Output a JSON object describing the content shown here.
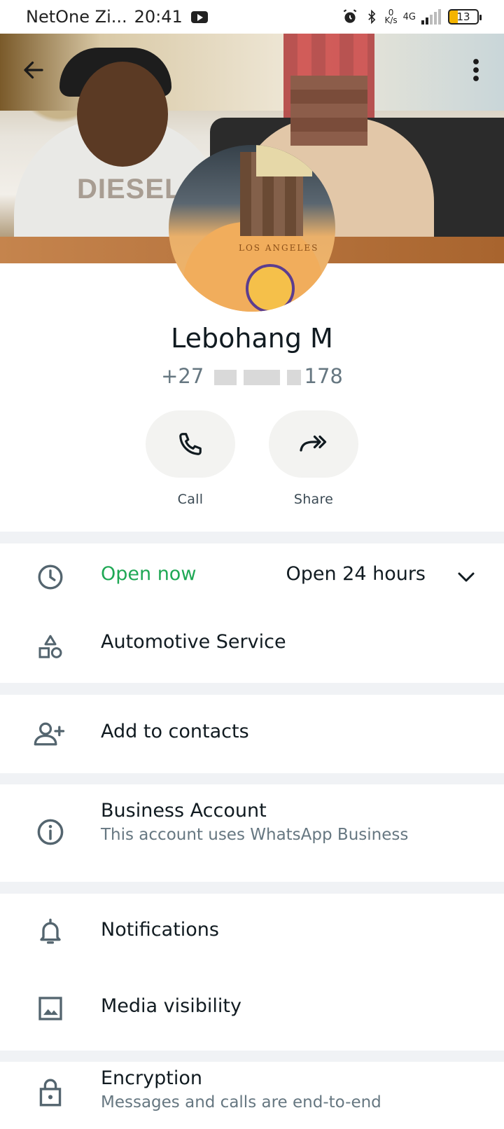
{
  "status_bar": {
    "carrier": "NetOne Zi...",
    "time": "20:41",
    "speed_value": "0",
    "speed_unit": "K/s",
    "network": "4G",
    "battery": "13"
  },
  "profile": {
    "name": "Lebohang M",
    "phone_prefix": "+27",
    "phone_suffix": "178",
    "cover_text": "DIESEL",
    "avatar_text": "LOS ANGELES"
  },
  "actions": [
    {
      "label": "Call",
      "icon": "phone-icon"
    },
    {
      "label": "Share",
      "icon": "share-icon"
    }
  ],
  "hours": {
    "status": "Open now",
    "status_color": "#1fa855",
    "value": "Open 24 hours",
    "category": "Automotive Service"
  },
  "contacts": {
    "label": "Add to contacts"
  },
  "business": {
    "title": "Business Account",
    "subtitle": "This account uses WhatsApp Business"
  },
  "prefs": {
    "notifications": "Notifications",
    "media": "Media visibility"
  },
  "encryption": {
    "title": "Encryption",
    "subtitle": "Messages and calls are end-to-end"
  }
}
